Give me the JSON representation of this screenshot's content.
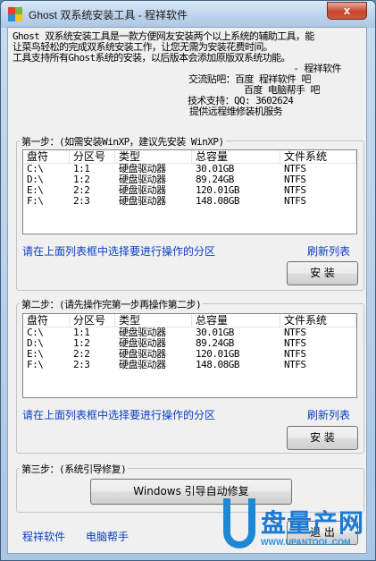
{
  "window": {
    "title": "Ghost 双系统安装工具 - 程祥软件",
    "close_label": "x"
  },
  "info": {
    "line1": "Ghost 双系统安装工具是一款方便网友安装两个以上系统的辅助工具，能",
    "line2": "让菜鸟轻松的完成双系统安装工作，让您无需为安装花费时间。",
    "line3": "工具支持所有Ghost系统的安装，以后版本会添加原版双系统功能。",
    "line4": "- 程祥软件",
    "forum_label": "交流贴吧：",
    "forum1": "百度 程祥软件 吧",
    "forum2": "百度 电脑帮手 吧",
    "support": "技术支持：QQ: 3602624",
    "service": "提供远程维修装机服务"
  },
  "step1": {
    "title": "第一步：(如需安装WinXP，建议先安装 WinXP)",
    "hint": "请在上面列表框中选择要进行操作的分区",
    "refresh": "刷新列表",
    "install": "安 装"
  },
  "step2": {
    "title": "第二步：(请先操作完第一步再操作第二步)",
    "hint": "请在上面列表框中选择要进行操作的分区",
    "refresh": "刷新列表",
    "install": "安 装"
  },
  "step3": {
    "title": "第三步：(系统引导修复)",
    "repair": "Windows 引导自动修复"
  },
  "columns": [
    "盘符",
    "分区号",
    "类型",
    "总容量",
    "文件系统"
  ],
  "partitions": [
    [
      "C:\\",
      "1:1",
      "硬盘驱动器",
      "30.01GB",
      "NTFS"
    ],
    [
      "D:\\",
      "1:2",
      "硬盘驱动器",
      "89.24GB",
      "NTFS"
    ],
    [
      "E:\\",
      "2:2",
      "硬盘驱动器",
      "120.01GB",
      "NTFS"
    ],
    [
      "F:\\",
      "2:3",
      "硬盘驱动器",
      "148.08GB",
      "NTFS"
    ]
  ],
  "footer": {
    "link1": "程祥软件",
    "link2": "电脑帮手",
    "exit": "退 出"
  },
  "watermark": {
    "brand": "盘量产网",
    "url": "WWW.UPANTOOL.COM"
  }
}
